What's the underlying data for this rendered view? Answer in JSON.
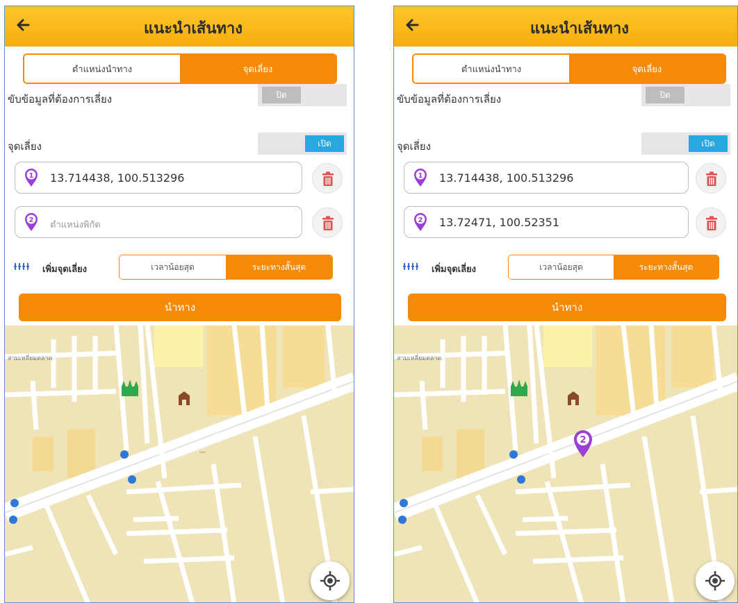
{
  "screens": [
    {
      "title": "แนะนำเส้นทาง",
      "tabs": {
        "left": "ตำแหน่งนำทาง",
        "right": "จุดเลี่ยง"
      },
      "row1_label": "ขับข้อมูลที่ต้องการเลี่ยง",
      "row1_toggle": "ปิด",
      "row2_label": "จุดเลี่ยง",
      "row2_toggle": "เปิด",
      "point1": {
        "value": "13.714438, 100.513296"
      },
      "point2": {
        "value": "",
        "placeholder": "ตำแหน่งพิกัด"
      },
      "add_label": "เพิ่มจุดเลี่ยง",
      "options": {
        "left": "เวลาน้อยสุด",
        "right": "ระยะทางสั้นสุด"
      },
      "navigate_label": "นำทาง",
      "map_label": "สามเหลี่ยมตลาด"
    },
    {
      "title": "แนะนำเส้นทาง",
      "tabs": {
        "left": "ตำแหน่งนำทาง",
        "right": "จุดเลี่ยง"
      },
      "row1_label": "ขับข้อมูลที่ต้องการเลี่ยง",
      "row1_toggle": "ปิด",
      "row2_label": "จุดเลี่ยง",
      "row2_toggle": "เปิด",
      "point1": {
        "value": "13.714438, 100.513296"
      },
      "point2": {
        "value": "13.72471, 100.52351",
        "placeholder": ""
      },
      "add_label": "เพิ่มจุดเลี่ยง",
      "options": {
        "left": "เวลาน้อยสุด",
        "right": "ระยะทางสั้นสุด"
      },
      "navigate_label": "นำทาง",
      "map_label": "สามเหลี่ยมตลาด",
      "map_marker": "2"
    }
  ],
  "colors": {
    "appbar": "#fbb813",
    "accent": "#f58a07",
    "toggle_on": "#2aa7de",
    "pin": "#9b40d6",
    "trash": "#d9534f"
  },
  "icons": [
    "back-arrow-icon",
    "location-pin-icon",
    "trash-icon",
    "add-waypoint-icon",
    "my-location-icon"
  ]
}
